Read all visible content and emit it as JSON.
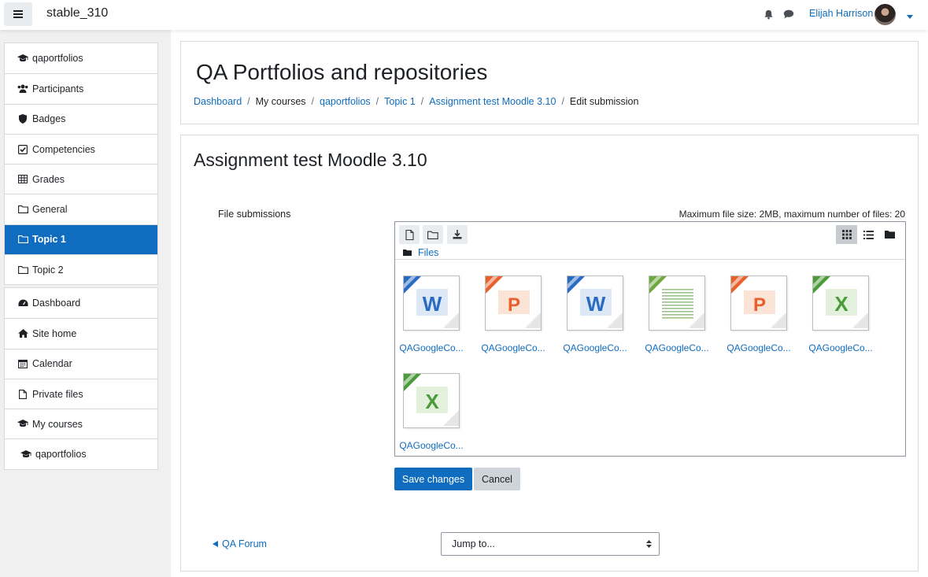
{
  "navbar": {
    "site_name": "stable_310",
    "user_name": "Elijah Harrison"
  },
  "drawer": {
    "course_items": [
      {
        "label": "qaportfolios",
        "icon": "graduation-cap-icon"
      },
      {
        "label": "Participants",
        "icon": "users-icon"
      },
      {
        "label": "Badges",
        "icon": "shield-icon"
      },
      {
        "label": "Competencies",
        "icon": "check-square-icon"
      },
      {
        "label": "Grades",
        "icon": "table-icon"
      },
      {
        "label": "General",
        "icon": "folder-icon"
      },
      {
        "label": "Topic 1",
        "icon": "folder-icon",
        "active": true
      },
      {
        "label": "Topic 2",
        "icon": "folder-icon"
      }
    ],
    "site_items": [
      {
        "label": "Dashboard",
        "icon": "dashboard-icon"
      },
      {
        "label": "Site home",
        "icon": "home-icon"
      },
      {
        "label": "Calendar",
        "icon": "calendar-icon"
      },
      {
        "label": "Private files",
        "icon": "file-icon"
      },
      {
        "label": "My courses",
        "icon": "graduation-cap-icon"
      },
      {
        "label": "qaportfolios",
        "icon": "graduation-cap-icon"
      }
    ]
  },
  "header": {
    "title": "QA Portfolios and repositories",
    "breadcrumb": [
      "Dashboard",
      "My courses",
      "qaportfolios",
      "Topic 1",
      "Assignment test Moodle 3.10",
      "Edit submission"
    ]
  },
  "main": {
    "activity_title": "Assignment test Moodle 3.10",
    "field_label": "File submissions",
    "max_info": "Maximum file size: 2MB, maximum number of files: 20",
    "path_label": "Files",
    "files": [
      {
        "name": "QAGoogleCo...",
        "type": "word"
      },
      {
        "name": "QAGoogleCo...",
        "type": "powerpoint"
      },
      {
        "name": "QAGoogleCo...",
        "type": "word"
      },
      {
        "name": "QAGoogleCo...",
        "type": "text"
      },
      {
        "name": "QAGoogleCo...",
        "type": "powerpoint"
      },
      {
        "name": "QAGoogleCo...",
        "type": "excel"
      },
      {
        "name": "QAGoogleCo...",
        "type": "excel"
      }
    ],
    "save_label": "Save changes",
    "cancel_label": "Cancel",
    "prev_link": "QA Forum",
    "jump_placeholder": "Jump to..."
  },
  "colors": {
    "primary": "#0f6cbf",
    "word": "#2a6bc4",
    "powerpoint": "#e8602c",
    "excel": "#4a9b3a",
    "text": "#6ea83e"
  }
}
